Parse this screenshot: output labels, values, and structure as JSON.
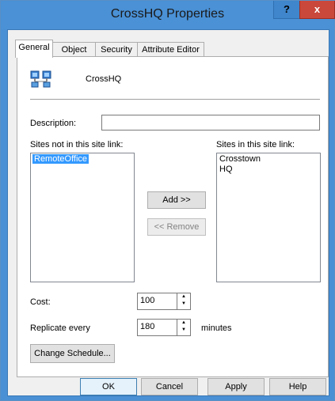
{
  "window": {
    "title": "CrossHQ Properties",
    "help_label": "?",
    "close_label": "x"
  },
  "tabs": [
    {
      "label": "General"
    },
    {
      "label": "Object"
    },
    {
      "label": "Security"
    },
    {
      "label": "Attribute Editor"
    }
  ],
  "general": {
    "object_name": "CrossHQ",
    "description_label": "Description:",
    "description_value": "",
    "sites_not_label": "Sites not in this site link:",
    "sites_in_label": "Sites in this site link:",
    "sites_not": [
      "RemoteOffice"
    ],
    "sites_in": [
      "Crosstown",
      "HQ"
    ],
    "add_label": "Add >>",
    "remove_label": "<< Remove",
    "cost_label": "Cost:",
    "cost_value": "100",
    "replicate_label": "Replicate every",
    "replicate_value": "180",
    "minutes_label": "minutes",
    "schedule_label": "Change Schedule..."
  },
  "footer": {
    "ok_label": "OK",
    "cancel_label": "Cancel",
    "apply_label": "Apply",
    "help_label": "Help"
  },
  "icons": {
    "site_link": "site-link-icon",
    "spin_up": "spin-up-icon",
    "spin_down": "spin-down-icon"
  },
  "colors": {
    "title_bar": "#4a91d6",
    "close": "#c9483b",
    "selection": "#3399ff"
  }
}
